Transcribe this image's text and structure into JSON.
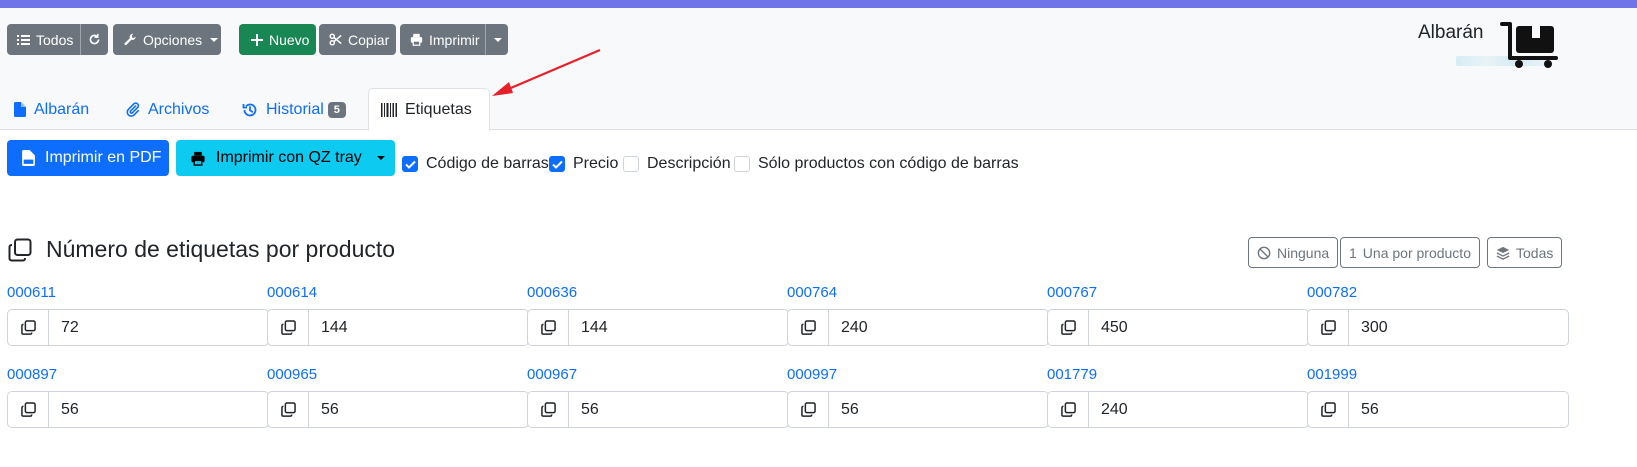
{
  "toolbar": {
    "todos_label": "Todos",
    "opciones_label": "Opciones",
    "nuevo_label": "Nuevo",
    "copiar_label": "Copiar",
    "imprimir_label": "Imprimir"
  },
  "brand": {
    "title": "Albarán"
  },
  "tabs": [
    {
      "label": "Albarán",
      "icon": "file-icon"
    },
    {
      "label": "Archivos",
      "icon": "paperclip-icon"
    },
    {
      "label": "Historial",
      "icon": "history-icon",
      "badge": "5"
    },
    {
      "label": "Etiquetas",
      "icon": "barcode-icon",
      "active": true
    }
  ],
  "actions": {
    "pdf_label": "Imprimir en PDF",
    "qz_label": "Imprimir con QZ tray"
  },
  "options": [
    {
      "label": "Código de barras",
      "checked": true
    },
    {
      "label": "Precio",
      "checked": true
    },
    {
      "label": "Descripción",
      "checked": false
    },
    {
      "label": "Sólo productos con código de barras",
      "checked": false
    }
  ],
  "section": {
    "title": "Número de etiquetas por producto",
    "ninguna_label": "Ninguna",
    "una_num": "1",
    "una_label": "Una por producto",
    "todas_label": "Todas"
  },
  "products": [
    {
      "code": "000611",
      "qty": "72"
    },
    {
      "code": "000614",
      "qty": "144"
    },
    {
      "code": "000636",
      "qty": "144"
    },
    {
      "code": "000764",
      "qty": "240"
    },
    {
      "code": "000767",
      "qty": "450"
    },
    {
      "code": "000782",
      "qty": "300"
    },
    {
      "code": "000897",
      "qty": "56"
    },
    {
      "code": "000965",
      "qty": "56"
    },
    {
      "code": "000967",
      "qty": "56"
    },
    {
      "code": "000997",
      "qty": "56"
    },
    {
      "code": "001779",
      "qty": "240"
    },
    {
      "code": "001999",
      "qty": "56"
    }
  ],
  "colors": {
    "primary": "#0d6efd",
    "secondary": "#6c757d",
    "success": "#198754",
    "info": "#0dcaf0",
    "topbar": "#6f74e8",
    "annotation_arrow": "#e8202a"
  }
}
